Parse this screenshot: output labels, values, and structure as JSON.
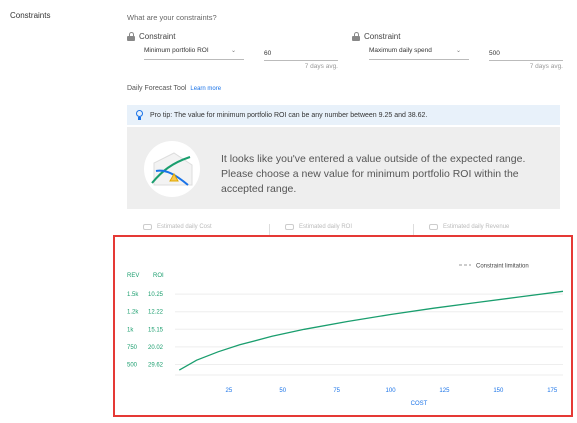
{
  "section": {
    "label": "Constraints"
  },
  "question": "What are your constraints?",
  "constraints": [
    {
      "title": "Constraint",
      "selected": "Minimum portfolio ROI",
      "value": "60",
      "hint": "7 days avg."
    },
    {
      "title": "Constraint",
      "selected": "Maximum daily spend",
      "value": "500",
      "hint": "7 days avg."
    }
  ],
  "tool": {
    "label": "Daily Forecast Tool",
    "learn_more": "Learn more"
  },
  "tip": {
    "text": "Pro tip: The value for minimum portfolio ROI can be any number between 9.25 and 38.62."
  },
  "warning": {
    "text": "It looks like you've entered a value outside of the expected range. Please choose a new value for minimum portfolio ROI within the accepted range."
  },
  "metrics": [
    {
      "label": "Estimated daily Cost",
      "icon": "cost-icon"
    },
    {
      "label": "Estimated daily ROI",
      "icon": "roi-icon"
    },
    {
      "label": "Estimated daily Revenue",
      "icon": "revenue-icon"
    }
  ],
  "colors": {
    "accent": "#1a73e8",
    "series": "#1a9e6e",
    "highlight_border": "#e53935",
    "tip_bg": "#e8f1fa",
    "warn_bg": "#eeeeee"
  },
  "chart_data": {
    "type": "line",
    "legend": {
      "label": "Constraint limitation",
      "placement": "top-right"
    },
    "xlabel": "COST",
    "x_ticks": [
      25,
      50,
      75,
      100,
      125,
      150,
      175
    ],
    "y_label_rev": "REV",
    "y_label_roi": "ROI",
    "y_ticks": [
      {
        "rev": "1.5k",
        "roi": "10.25",
        "value": 1500
      },
      {
        "rev": "1.2k",
        "roi": "12.22",
        "value": 1250
      },
      {
        "rev": "1k",
        "roi": "15.15",
        "value": 1000
      },
      {
        "rev": "750",
        "roi": "20.02",
        "value": 750
      },
      {
        "rev": "500",
        "roi": "29.62",
        "value": 500
      }
    ],
    "xlim": [
      0,
      180
    ],
    "ylim": [
      350,
      1800
    ],
    "series": [
      {
        "x": [
          2,
          10,
          20,
          30,
          45,
          60,
          80,
          100,
          120,
          140,
          160,
          180
        ],
        "y": [
          420,
          560,
          680,
          780,
          900,
          1000,
          1110,
          1210,
          1300,
          1380,
          1460,
          1540
        ]
      }
    ]
  }
}
